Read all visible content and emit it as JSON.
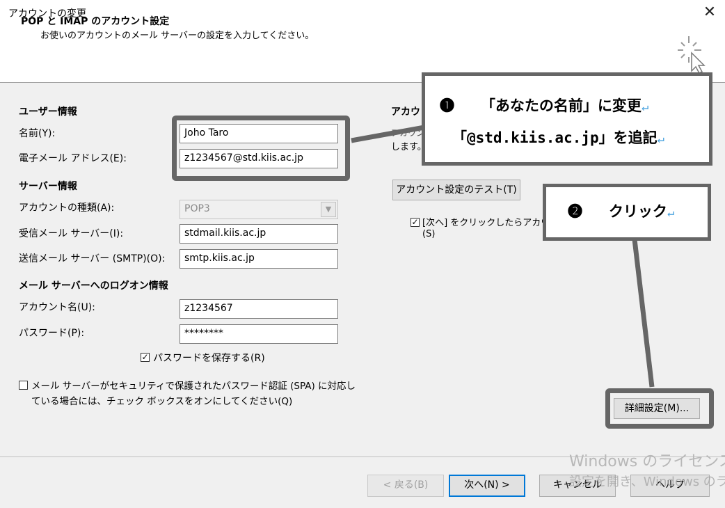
{
  "window": {
    "title": "アカウントの変更",
    "close_glyph": "✕"
  },
  "header": {
    "title": "POP と IMAP のアカウント設定",
    "subtitle": "お使いのアカウントのメール サーバーの設定を入力してください。"
  },
  "user_info": {
    "section": "ユーザー情報",
    "name_label": "名前(Y):",
    "name_value": "Joho Taro",
    "email_label": "電子メール アドレス(E):",
    "email_value": "z1234567@std.kiis.ac.jp"
  },
  "server_info": {
    "section": "サーバー情報",
    "account_type_label": "アカウントの種類(A):",
    "account_type_value": "POP3",
    "incoming_label": "受信メール サーバー(I):",
    "incoming_value": "stdmail.kiis.ac.jp",
    "outgoing_label": "送信メール サーバー (SMTP)(O):",
    "outgoing_value": "smtp.kiis.ac.jp"
  },
  "logon_info": {
    "section": "メール サーバーへのログオン情報",
    "account_name_label": "アカウント名(U):",
    "account_name_value": "z1234567",
    "password_label": "パスワード(P):",
    "password_value": "********",
    "save_password_label": "パスワードを保存する(R)",
    "save_password_checked": true,
    "spa_label_1": "メール サーバーがセキュリティで保護されたパスワード認証 (SPA) に対応し",
    "spa_label_2": "ている場合には、チェック ボックスをオンにしてください(Q)",
    "spa_checked": false
  },
  "test_settings": {
    "section_partial": "アカウ",
    "desc_partial_1": "アカウン",
    "desc_partial_2": "します。",
    "test_button": "アカウント設定のテスト(T)",
    "auto_test_label_partial": "[次へ] をクリックしたらアカウン",
    "auto_test_label_line2": "(S)",
    "auto_test_checked": true
  },
  "more_settings_button": "詳細設定(M)...",
  "footer": {
    "back": "< 戻る(B)",
    "next": "次へ(N) >",
    "cancel": "キャンセル",
    "help": "ヘルプ"
  },
  "annotations": {
    "callout1_marker": "❶",
    "callout1_line1": "「あなたの名前」に変更",
    "callout1_line2": "「@std.kiis.ac.jp」を追記",
    "callout2_marker": "❷",
    "callout2_text": "クリック",
    "return_glyph": "↵",
    "border_color": "#666666"
  },
  "watermark": {
    "line1": "Windows のライセンス",
    "line2": "設定を開き、Windows のラ"
  }
}
